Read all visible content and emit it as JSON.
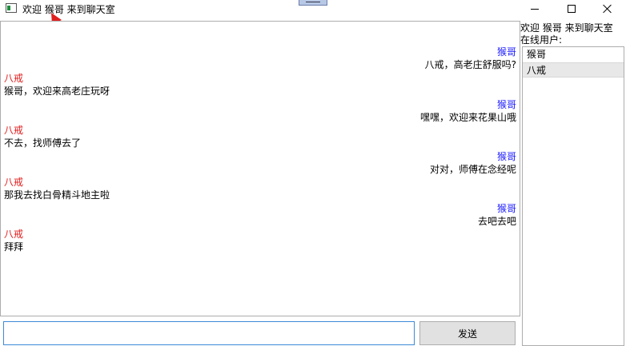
{
  "window": {
    "title": "欢迎 猴哥 来到聊天室",
    "controls": [
      "minimize-icon",
      "maximize-icon",
      "close-icon"
    ]
  },
  "colors": {
    "self_sender": "#1a1aff",
    "other_sender": "#e01b1b",
    "annotation_arrow": "#e02020",
    "input_border": "#3c8ad6"
  },
  "chat": {
    "messages": [
      {
        "sender": "猴哥",
        "text": "八戒，高老庄舒服吗?",
        "align": "right"
      },
      {
        "sender": "八戒",
        "text": "猴哥，欢迎来高老庄玩呀",
        "align": "left"
      },
      {
        "sender": "猴哥",
        "text": "嘿嘿，欢迎来花果山哦",
        "align": "right"
      },
      {
        "sender": "八戒",
        "text": "不去，找师傅去了",
        "align": "left"
      },
      {
        "sender": "猴哥",
        "text": "对对，师傅在念经呢",
        "align": "right"
      },
      {
        "sender": "八戒",
        "text": "那我去找白骨精斗地主啦",
        "align": "left"
      },
      {
        "sender": "猴哥",
        "text": "去吧去吧",
        "align": "right"
      },
      {
        "sender": "八戒",
        "text": "拜拜",
        "align": "left"
      }
    ]
  },
  "sidebar": {
    "welcome": "欢迎 猴哥 来到聊天室",
    "online_label": "在线用户:",
    "users": [
      {
        "name": "猴哥",
        "selected": false
      },
      {
        "name": "八戒",
        "selected": true
      }
    ]
  },
  "composer": {
    "value": "",
    "send_label": "发送"
  }
}
